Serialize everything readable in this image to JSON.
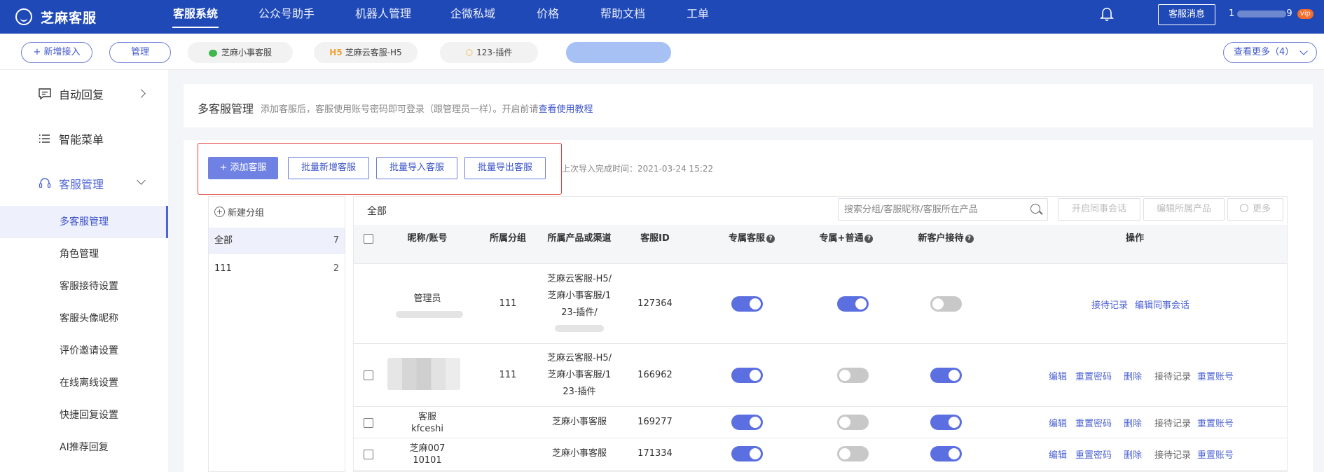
{
  "header": {
    "app_name": "芝麻客服",
    "nav": [
      "客服系统",
      "公众号助手",
      "机器人管理",
      "企微私域",
      "价格",
      "帮助文档",
      "工单"
    ],
    "active_nav": "客服系统",
    "message_button": "客服消息",
    "user_prefix": "1",
    "user_suffix": "9",
    "vip_badge": "vip"
  },
  "channel_bar": {
    "add_button": "新增接入",
    "manage_button": "管理",
    "channels": [
      {
        "label": "芝麻小事客服",
        "icon": "wechat-icon"
      },
      {
        "prefix": "H5",
        "label": "芝麻云客服-H5",
        "icon": "h5-icon"
      },
      {
        "label": "123-插件",
        "icon": "box-icon"
      }
    ],
    "more_button": "查看更多（4）"
  },
  "sidebar": {
    "groups": [
      {
        "label": "自动回复",
        "icon": "message-square-icon"
      },
      {
        "label": "智能菜单",
        "icon": "list-icon"
      },
      {
        "label": "客服管理",
        "icon": "headset-icon"
      }
    ],
    "sub_items": [
      "多客服管理",
      "角色管理",
      "客服接待设置",
      "客服头像昵称",
      "评价邀请设置",
      "在线离线设置",
      "快捷回复设置",
      "AI推荐回复"
    ],
    "active_sub": "多客服管理"
  },
  "intro": {
    "title": "多客服管理",
    "desc": "添加客服后，客服使用账号密码即可登录（跟管理员一样）。开启前请",
    "link": "查看使用教程"
  },
  "toolbar": {
    "add": "+ 添加客服",
    "batch_add": "批量新增客服",
    "batch_import": "批量导入客服",
    "batch_export": "批量导出客服",
    "import_time": "上次导入完成时间：2021-03-24 15:22"
  },
  "groups_panel": {
    "new_group": "新建分组",
    "items": [
      {
        "name": "全部",
        "count": "7"
      },
      {
        "name": "111",
        "count": "2"
      }
    ]
  },
  "table": {
    "all_label": "全部",
    "search_placeholder": "搜索分组/客服昵称/客服所在产品",
    "enable_colleague": "开启同事会话",
    "edit_product": "编辑所属产品",
    "more": "更多",
    "headers": {
      "name": "昵称/账号",
      "group": "所属分组",
      "product": "所属产品或渠道",
      "id": "客服ID",
      "exclusive": "专属客服",
      "exclusive_normal": "专属+普通",
      "new_customer": "新客户接待",
      "actions": "操作"
    },
    "rows": [
      {
        "name": "管理员",
        "group": "111",
        "product_lines": [
          "芝麻云客服-H5/",
          "芝麻小事客服/1",
          "23-插件/"
        ],
        "id": "127364",
        "exclusive": true,
        "exclusive_normal": true,
        "new_customer": false,
        "actions": [
          "接待记录",
          "编辑同事会话"
        ]
      },
      {
        "name": "",
        "group": "111",
        "product_lines": [
          "芝麻云客服-H5/",
          "芝麻小事客服/1",
          "23-插件"
        ],
        "id": "166962",
        "exclusive": true,
        "exclusive_normal": false,
        "new_customer": true,
        "actions": [
          "编辑",
          "重置密码",
          "删除",
          "接待记录",
          "重置账号"
        ]
      },
      {
        "name": "客服",
        "account": "kfceshi",
        "group": "",
        "product_lines": [
          "芝麻小事客服"
        ],
        "id": "169277",
        "exclusive": true,
        "exclusive_normal": false,
        "new_customer": true,
        "actions": [
          "编辑",
          "重置密码",
          "删除",
          "接待记录",
          "重置账号"
        ]
      },
      {
        "name": "芝麻007",
        "account": "10101",
        "group": "",
        "product_lines": [
          "芝麻小事客服"
        ],
        "id": "171334",
        "exclusive": true,
        "exclusive_normal": false,
        "new_customer": true,
        "actions": [
          "编辑",
          "重置密码",
          "删除",
          "接待记录",
          "重置账号"
        ]
      }
    ]
  }
}
